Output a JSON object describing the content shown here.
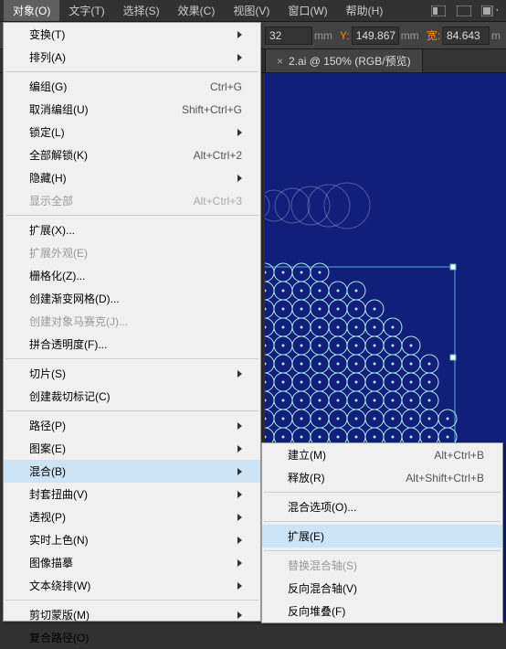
{
  "menubar": {
    "items": [
      "对象(O)",
      "文字(T)",
      "选择(S)",
      "效果(C)",
      "视图(V)",
      "窗口(W)",
      "帮助(H)"
    ]
  },
  "toolbar": {
    "x_suffix": "32",
    "unit": "mm",
    "y_label": "Y:",
    "y_value": "149.867",
    "w_label": "宽:",
    "w_value": "84.643",
    "unit2": "m"
  },
  "tab": {
    "close": "×",
    "title": "2.ai @ 150% (RGB/预览)"
  },
  "menu_main": [
    {
      "t": "变换(T)",
      "sub": true
    },
    {
      "t": "排列(A)",
      "sub": true
    },
    {
      "sep": true
    },
    {
      "t": "编组(G)",
      "s": "Ctrl+G"
    },
    {
      "t": "取消编组(U)",
      "s": "Shift+Ctrl+G"
    },
    {
      "t": "锁定(L)",
      "sub": true
    },
    {
      "t": "全部解锁(K)",
      "s": "Alt+Ctrl+2"
    },
    {
      "t": "隐藏(H)",
      "sub": true
    },
    {
      "t": "显示全部",
      "s": "Alt+Ctrl+3",
      "dis": true
    },
    {
      "sep": true
    },
    {
      "t": "扩展(X)..."
    },
    {
      "t": "扩展外观(E)",
      "dis": true
    },
    {
      "t": "栅格化(Z)..."
    },
    {
      "t": "创建渐变网格(D)..."
    },
    {
      "t": "创建对象马赛克(J)...",
      "dis": true
    },
    {
      "t": "拼合透明度(F)..."
    },
    {
      "sep": true
    },
    {
      "t": "切片(S)",
      "sub": true
    },
    {
      "t": "创建裁切标记(C)"
    },
    {
      "sep": true
    },
    {
      "t": "路径(P)",
      "sub": true
    },
    {
      "t": "图案(E)",
      "sub": true
    },
    {
      "t": "混合(B)",
      "sub": true,
      "hl": true
    },
    {
      "t": "封套扭曲(V)",
      "sub": true
    },
    {
      "t": "透视(P)",
      "sub": true
    },
    {
      "t": "实时上色(N)",
      "sub": true
    },
    {
      "t": "图像描摹",
      "sub": true
    },
    {
      "t": "文本绕排(W)",
      "sub": true
    },
    {
      "sep": true
    },
    {
      "t": "剪切蒙版(M)",
      "sub": true
    },
    {
      "t": "复合路径(O)",
      "sub": true
    }
  ],
  "menu_sub": [
    {
      "t": "建立(M)",
      "s": "Alt+Ctrl+B"
    },
    {
      "t": "释放(R)",
      "s": "Alt+Shift+Ctrl+B"
    },
    {
      "sep": true
    },
    {
      "t": "混合选项(O)..."
    },
    {
      "sep": true
    },
    {
      "t": "扩展(E)",
      "hl": true
    },
    {
      "sep": true
    },
    {
      "t": "替换混合轴(S)",
      "dis": true
    },
    {
      "t": "反向混合轴(V)"
    },
    {
      "t": "反向堆叠(F)"
    }
  ]
}
